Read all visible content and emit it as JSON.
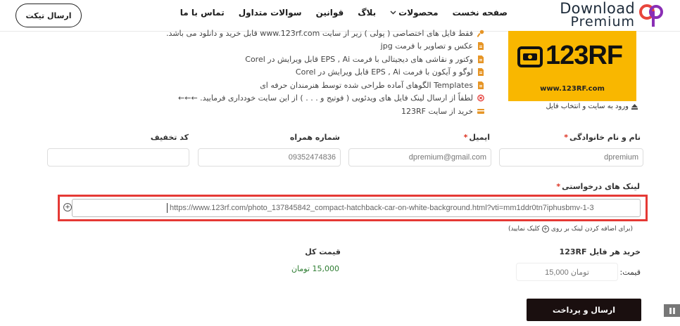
{
  "header": {
    "ticket_button": "ارسال تیکت",
    "nav": [
      {
        "label": "صفحه نخست"
      },
      {
        "label": "محصولات"
      },
      {
        "label": "بلاگ"
      },
      {
        "label": "قوانین"
      },
      {
        "label": "سوالات متداول"
      },
      {
        "label": "تماس با ما"
      }
    ],
    "logo_line1": "Download",
    "logo_line2": "Premium"
  },
  "promo": {
    "brand": "123RF",
    "url": "www.123RF.com",
    "login_link": "ورود به سایت و انتخاب فایل"
  },
  "features": [
    {
      "text": "فقط فایل های اختصاصی ( پولی ) زیر از سایت www.123rf.com قابل خرید و دانلود می باشد.",
      "icon": "key-icon",
      "color": "#e69526"
    },
    {
      "text": "عکس و تصاویر با فرمت jpg",
      "icon": "file-icon",
      "color": "#e69526"
    },
    {
      "text": "وکتور و نقاشی های دیجیتالی با فرمت EPS , Ai قابل ویرایش در Corel",
      "icon": "file-icon",
      "color": "#e69526"
    },
    {
      "text": "لوگو و آیکون با فرمت EPS , Ai قابل ویرایش در Corel",
      "icon": "file-icon",
      "color": "#e69526"
    },
    {
      "text": "Templates الگوهای آماده طراحی شده توسط هنرمندان حرفه ای",
      "icon": "file-icon",
      "color": "#e69526"
    },
    {
      "text": "لطفاً از ارسال لینک فایل های ویدئویی ( فوتیج و . . . ) از این سایت خودداری فرمایید. ←←←",
      "icon": "x-circle-icon",
      "color": "#e53935"
    },
    {
      "text": "خرید از سایت 123RF",
      "icon": "card-icon",
      "color": "#e69526"
    }
  ],
  "form": {
    "name_label": "نام و نام خانوادگی",
    "name_value": "dpremium",
    "email_label": "ایمیل",
    "email_value": "dpremium@gmail.com",
    "phone_label": "شماره همراه",
    "phone_value": "09352474836",
    "discount_label": "کد تخفیف",
    "discount_value": "",
    "required_mark": "*",
    "links_label": "لینک های درخواستی",
    "link_value": "https://www.123rf.com/photo_137845842_compact-hatchback-car-on-white-background.html?vti=mm1ddr0tn7iphusbmv-1-3",
    "add_hint_prefix": "(برای اضافه کردن لینک بر روی",
    "add_hint_suffix": "کلیک نمایید)"
  },
  "pricing": {
    "per_file_label": "خرید هر فایل 123RF",
    "price_label": "قیمت:",
    "price_value": "15,000 تومان",
    "total_label": "قیمت کل",
    "total_value": "15,000 تومان",
    "total_color": "#2e7d32"
  },
  "submit_button": "ارسال و پرداخت",
  "colors": {
    "accent_red": "#e53935",
    "promo_yellow": "#f9b700",
    "button_dark": "#1a0f0f"
  }
}
